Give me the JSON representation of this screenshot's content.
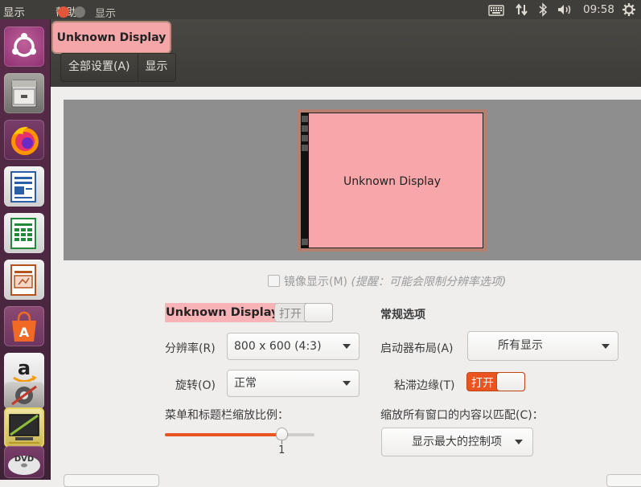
{
  "topbar": {
    "menu_display": "显示",
    "menu_help": "帮助",
    "time": "09:58",
    "icons": [
      "keyboard-icon",
      "network-icon",
      "bluetooth-icon",
      "volume-icon",
      "power-gear-icon"
    ]
  },
  "launcher": {
    "items": [
      "ubuntu-dash-icon",
      "files-icon",
      "firefox-icon",
      "writer-icon",
      "calc-icon",
      "impress-icon",
      "software-center-icon",
      "amazon-icon",
      "system-settings-icon",
      "display-settings-icon",
      "dvd-icon"
    ]
  },
  "window": {
    "title": "显示",
    "tooltip": "Unknown Display",
    "breadcrumbs": [
      "全部设置(A)",
      "显示"
    ]
  },
  "preview": {
    "monitor_label": "Unknown Display"
  },
  "mirror": {
    "label": "镜像显示(M)",
    "hint": "(提醒：可能会限制分辨率选项)"
  },
  "display": {
    "name": "Unknown Display",
    "toggle_label": "打开",
    "resolution_label": "分辨率(R)",
    "resolution_value": "800 x 600 (4:3)",
    "rotation_label": "旋转(O)",
    "rotation_value": "正常",
    "scale_label": "菜单和标题栏缩放比例：",
    "scale_value": "1",
    "scale_fraction": 0.78
  },
  "general": {
    "heading": "常规选项",
    "launcher_label": "启动器布局(A)",
    "launcher_value": "所有显示",
    "sticky_label": "粘滞边缘(T)",
    "sticky_toggle": "打开",
    "scale_all_label": "缩放所有窗口的内容以匹配(C)：",
    "scale_all_value": "显示最大的控制项"
  },
  "colors": {
    "accent": "#e95420",
    "monitor_fill": "#f7a6aa",
    "panel": "#403e3a"
  }
}
